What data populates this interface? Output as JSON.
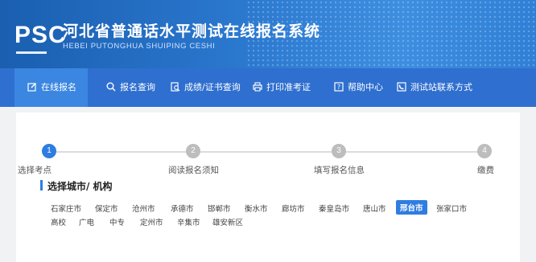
{
  "header": {
    "logo": "PSC",
    "title": "河北省普通话水平测试在线报名系统",
    "subtitle": "HEBEI PUTONGHUA SHUIPING CESHI"
  },
  "nav": {
    "items": [
      {
        "label": "在线报名",
        "icon": "edit-icon",
        "active": true
      },
      {
        "label": "报名查询",
        "icon": "search-icon",
        "active": false
      },
      {
        "label": "成绩/证书查询",
        "icon": "document-search-icon",
        "active": false
      },
      {
        "label": "打印准考证",
        "icon": "printer-icon",
        "active": false
      },
      {
        "label": "帮助中心",
        "icon": "help-icon",
        "active": false
      },
      {
        "label": "测试站联系方式",
        "icon": "phone-icon",
        "active": false
      }
    ]
  },
  "steps": [
    {
      "num": "1",
      "label": "选择考点",
      "done": true
    },
    {
      "num": "2",
      "label": "阅读报名须知",
      "done": false
    },
    {
      "num": "3",
      "label": "填写报名信息",
      "done": false
    },
    {
      "num": "4",
      "label": "缴费",
      "done": false
    }
  ],
  "section": {
    "title": "选择城市/ 机构"
  },
  "cities": {
    "row1": [
      "石家庄市",
      "保定市",
      "沧州市",
      "承德市",
      "邯郸市",
      "衡水市",
      "廊坊市",
      "秦皇岛市",
      "唐山市",
      "邢台市",
      "张家口市"
    ],
    "row2": [
      "高校",
      "广电",
      "中专",
      "定州市",
      "辛集市",
      "雄安新区"
    ],
    "selected": "邢台市"
  },
  "colors": {
    "banner": "#2b78cf",
    "nav": "#2f6fcf",
    "accent": "#2f7de0"
  }
}
